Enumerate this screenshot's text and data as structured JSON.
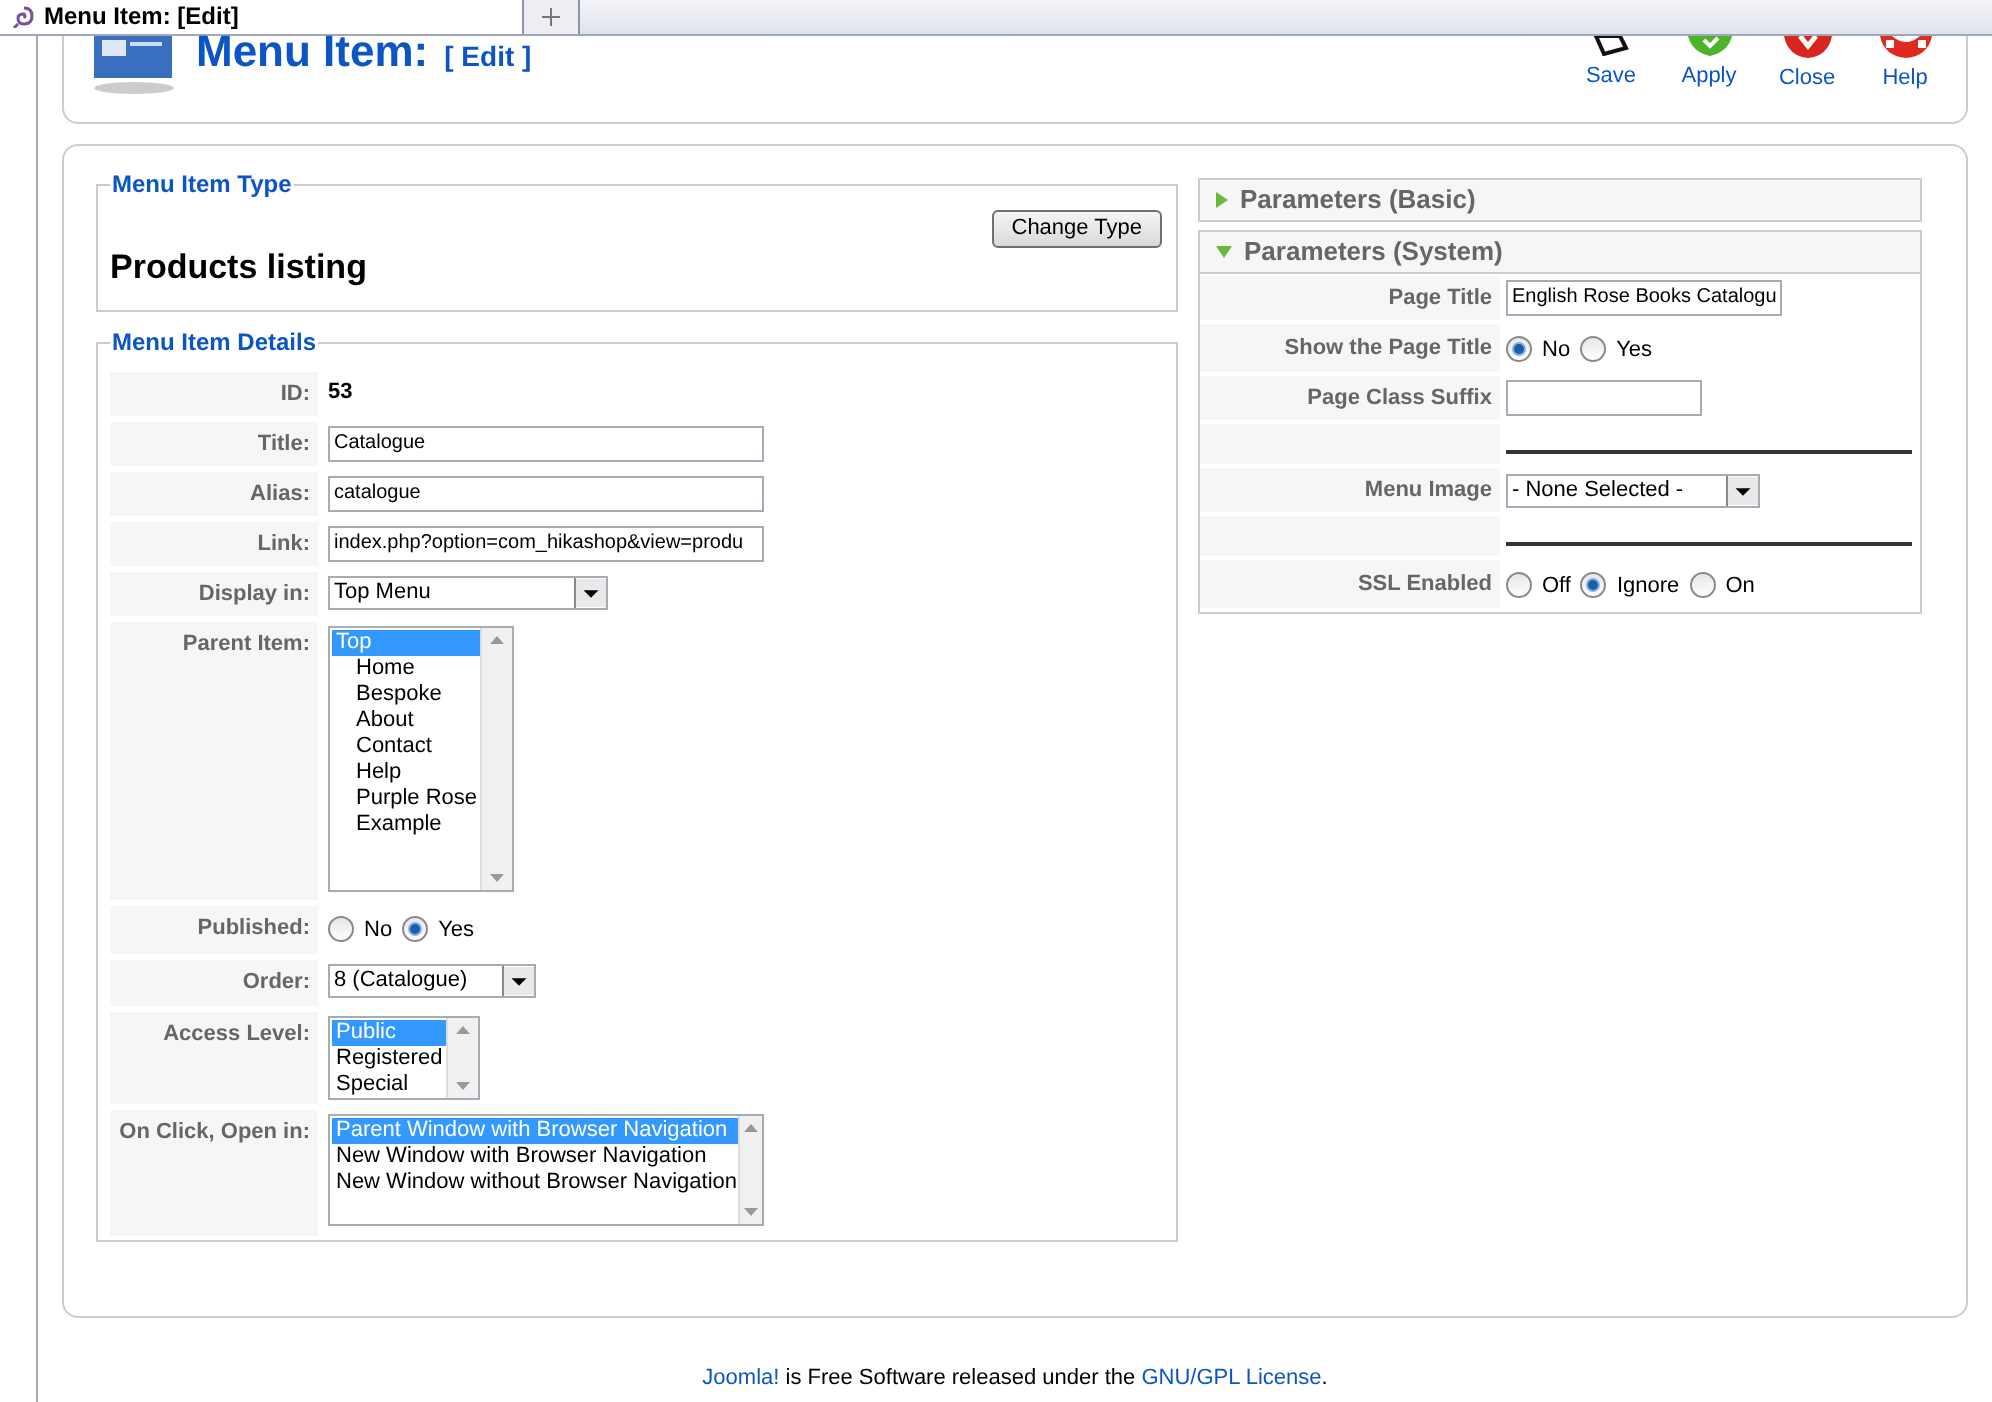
{
  "browser_tab": {
    "title": "Menu Item: [Edit]"
  },
  "header": {
    "title": "Menu Item:",
    "subtitle": "[ Edit ]"
  },
  "toolbar": [
    {
      "kind": "save",
      "label": "Save"
    },
    {
      "kind": "apply",
      "label": "Apply"
    },
    {
      "kind": "close",
      "label": "Close"
    },
    {
      "kind": "help",
      "label": "Help"
    }
  ],
  "menu_item_type": {
    "legend": "Menu Item Type",
    "value": "Products listing",
    "button": "Change Type"
  },
  "details": {
    "legend": "Menu Item Details",
    "rows": [
      {
        "kind": "text",
        "label": "ID:",
        "value": "53"
      },
      {
        "kind": "input",
        "label": "Title:",
        "value": "Catalogue"
      },
      {
        "kind": "input",
        "label": "Alias:",
        "value": "catalogue"
      },
      {
        "kind": "input",
        "label": "Link:",
        "value": "index.php?option=com_hikashop&view=produ"
      },
      {
        "kind": "select",
        "label": "Display in:",
        "value": "Top Menu"
      },
      {
        "kind": "listbox",
        "label": "Parent Item:",
        "options": [
          {
            "label": "Top",
            "selected": true,
            "children": [
              {
                "label": "Home",
                "selected": false
              },
              {
                "label": "Bespoke",
                "selected": false
              },
              {
                "label": "About",
                "selected": false
              },
              {
                "label": "Contact",
                "selected": false
              },
              {
                "label": "Help",
                "selected": false
              },
              {
                "label": "Purple Rose",
                "selected": false
              },
              {
                "label": "Example",
                "selected": false
              }
            ]
          }
        ]
      },
      {
        "kind": "radio",
        "label": "Published:",
        "options": [
          {
            "label": "No",
            "selected": false
          },
          {
            "label": "Yes",
            "selected": true
          }
        ]
      },
      {
        "kind": "select",
        "label": "Order:",
        "value": "8 (Catalogue)"
      },
      {
        "kind": "listbox",
        "label": "Access Level:",
        "options": [
          {
            "label": "Public",
            "selected": true
          },
          {
            "label": "Registered",
            "selected": false
          },
          {
            "label": "Special",
            "selected": false
          }
        ]
      },
      {
        "kind": "listbox",
        "label": "On Click, Open in:",
        "options": [
          {
            "label": "Parent Window with Browser Navigation",
            "selected": true
          },
          {
            "label": "New Window with Browser Navigation",
            "selected": false
          },
          {
            "label": "New Window without Browser Navigation",
            "selected": false
          }
        ]
      }
    ]
  },
  "parameters": [
    {
      "title": "Parameters (Basic)",
      "expanded": false
    },
    {
      "title": "Parameters (System)",
      "expanded": true,
      "rows": [
        {
          "kind": "input",
          "label": "Page Title",
          "value": "English Rose Books Catalogu"
        },
        {
          "kind": "radio",
          "label": "Show the Page Title",
          "options": [
            {
              "label": "No",
              "selected": true
            },
            {
              "label": "Yes",
              "selected": false
            }
          ]
        },
        {
          "kind": "input",
          "label": "Page Class Suffix"
        },
        {
          "kind": "separator"
        },
        {
          "kind": "select",
          "label": "Menu Image",
          "value": "- None Selected -"
        },
        {
          "kind": "separator"
        },
        {
          "kind": "radio",
          "label": "SSL Enabled",
          "options": [
            {
              "label": "Off",
              "selected": false
            },
            {
              "label": "Ignore",
              "selected": true
            },
            {
              "label": "On",
              "selected": false
            }
          ]
        }
      ]
    }
  ],
  "footer": {
    "links": [
      "Joomla!",
      "GNU/GPL License"
    ],
    "text": " is Free Software released under the ",
    "end": "."
  }
}
